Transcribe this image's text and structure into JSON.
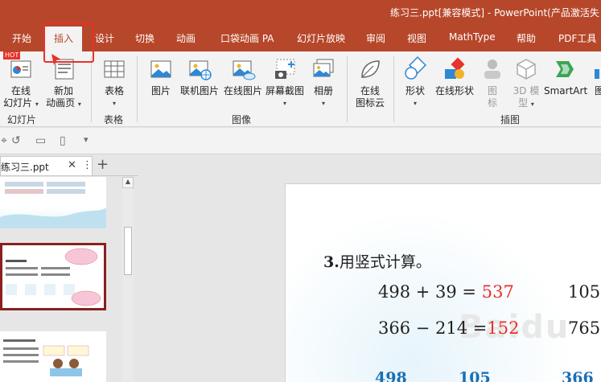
{
  "titlebar": {
    "title": "练习三.ppt[兼容模式] - PowerPoint(产品激活失"
  },
  "tabs": [
    "开始",
    "插入",
    "设计",
    "切换",
    "动画",
    "口袋动画 PA",
    "幻灯片放映",
    "审阅",
    "视图",
    "MathType",
    "帮助",
    "PDF工具"
  ],
  "ribbon": {
    "online_slide": {
      "line1": "在线",
      "line2": "幻灯片",
      "hot": "HOT"
    },
    "new_slide": {
      "line1": "新加",
      "line2": "动画页"
    },
    "table": {
      "label": "表格"
    },
    "picture": {
      "label": "图片"
    },
    "online_picture": {
      "label": "联机图片"
    },
    "online_picture2": {
      "label": "在线图片"
    },
    "screenshot": {
      "label": "屏幕截图"
    },
    "album": {
      "label": "相册"
    },
    "online_icon": {
      "line1": "在线",
      "line2": "图标云"
    },
    "shapes": {
      "label": "形状"
    },
    "online_shapes": {
      "label": "在线形状"
    },
    "icons": {
      "line1": "图",
      "line2": "标"
    },
    "model3d": {
      "line1": "3D 模",
      "line2": "型"
    },
    "smartart": {
      "label": "SmartArt"
    },
    "chart": {
      "label": "图"
    },
    "groups": {
      "slides": "幻灯片",
      "tables": "表格",
      "images": "图像",
      "illustrations": "插图"
    }
  },
  "pane": {
    "file_tab": "练习三.ppt"
  },
  "slide": {
    "heading_num": "3.",
    "heading": "用竖式计算。",
    "row1": {
      "expr": "498 + 39 =",
      "answer": "537",
      "right": "105 -"
    },
    "row2": {
      "expr": "366 − 214 =",
      "answer": "152",
      "right": "765 -"
    },
    "row3": [
      "498",
      "105",
      "366"
    ]
  },
  "colors": {
    "accent": "#b7472a",
    "highlight": "#e8312a",
    "answer_red": "#e8312a",
    "vertical_blue": "#1a6fb5"
  }
}
